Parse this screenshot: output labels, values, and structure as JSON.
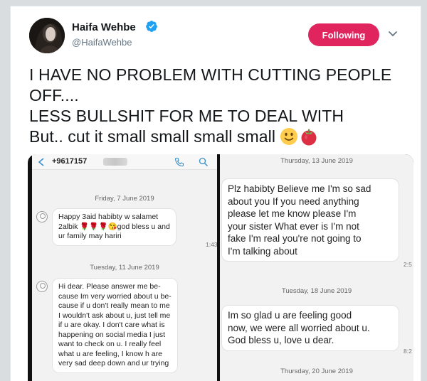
{
  "user": {
    "name": "Haifa Wehbe",
    "handle": "@HaifaWehbe",
    "follow_label": "Following"
  },
  "tweet": {
    "lines": [
      "I HAVE NO PROBLEM WITH CUTTING  PEOPLE",
      "OFF....",
      "LESS BULLSHIT FOR ME TO DEAL WITH",
      "But.. cut it small small small small"
    ],
    "emojis": [
      "slightly-smiling-face",
      "tomato"
    ]
  },
  "left_screenshot": {
    "phone_number": "+9617157",
    "date1": "Friday, 7 June 2019",
    "msg1": [
      "Happy 3aid habibty w salamet",
      "2albik 🌹🌹🌹😘god bless u and",
      "ur family may hariri"
    ],
    "time1": "1:43",
    "date2": "Tuesday, 11 June 2019",
    "msg2": [
      "Hi dear. Please answer me be-",
      "cause Im very worried about u be-",
      "cause if u don't really mean to me",
      "I wouldn't ask about u, just tell me",
      "if u are okay. I don't care what is",
      "happening on social media I just",
      "want to check on u. I really feel",
      "what u are feeling, I know h are",
      "very sad deep down and ur trying"
    ]
  },
  "right_screenshot": {
    "date0": "Thursday, 13 June 2019",
    "msg1": [
      "Plz habibty Believe me I'm so sad",
      "about you If you need anything",
      "please let me know please I'm",
      "your sister What ever is  I'm not",
      "fake I'm real you're not going to",
      "I'm talking about"
    ],
    "time1": "2:5",
    "date1": "Tuesday, 18 June 2019",
    "msg2": [
      "Im so glad u are feeling good",
      "now, we were all worried about u.",
      "God bless u, love u dear."
    ],
    "time2": "8:2",
    "date2": "Thursday, 20 June 2019"
  },
  "colors": {
    "follow_button": "#e0245e",
    "verified": "#1da1f2",
    "text": "#14171a",
    "handle": "#657786"
  }
}
